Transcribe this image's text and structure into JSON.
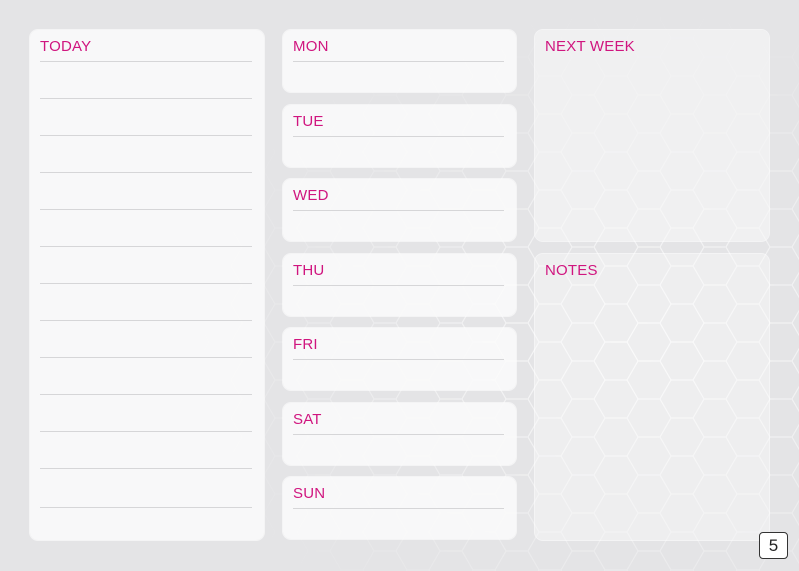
{
  "today": {
    "title": "TODAY"
  },
  "week_days": [
    {
      "title": "MON"
    },
    {
      "title": "TUE"
    },
    {
      "title": "WED"
    },
    {
      "title": "THU"
    },
    {
      "title": "FRI"
    },
    {
      "title": "SAT"
    },
    {
      "title": "SUN"
    }
  ],
  "next_week": {
    "title": "NEXT WEEK"
  },
  "notes": {
    "title": "NOTES"
  },
  "page_number": "5",
  "colors": {
    "heading": "#d0157f",
    "background": "#e4e4e6",
    "panel": "#fafafa",
    "rule": "#d6d6d8"
  }
}
